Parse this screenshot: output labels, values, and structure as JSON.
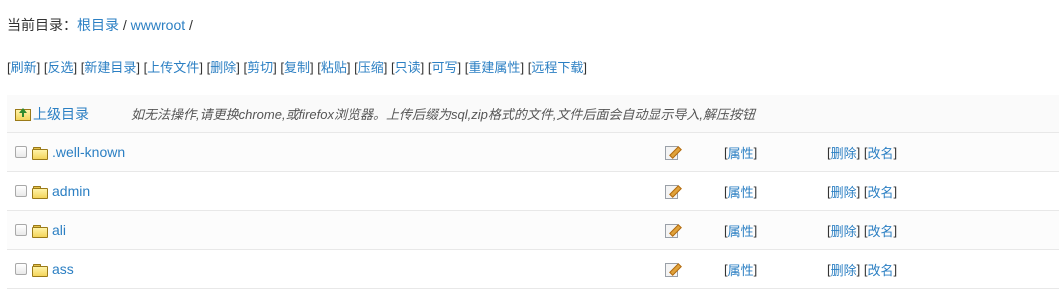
{
  "breadcrumb": {
    "prefix": "当前目录：",
    "root_label": "根目录",
    "sep1": " / ",
    "current": "wwwroot",
    "sep2": " /"
  },
  "toolbar": {
    "items": [
      "刷新",
      "反选",
      "新建目录",
      "上传文件",
      "删除",
      "剪切",
      "复制",
      "粘贴",
      "压缩",
      "只读",
      "可写",
      "重建属性",
      "远程下载"
    ]
  },
  "list": {
    "updir_label": "上级目录",
    "notice": "如无法操作,请更换chrome,或firefox浏览器。上传后缀为sql,zip格式的文件,文件后面会自动显示导入,解压按钮",
    "attr_label": "属性",
    "delete_label": "删除",
    "rename_label": "改名",
    "rows": [
      {
        "name": ".well-known"
      },
      {
        "name": "admin"
      },
      {
        "name": "ali"
      },
      {
        "name": "ass"
      }
    ]
  },
  "icons": {
    "folder": "folder-icon",
    "updir": "folder-up-icon",
    "edit": "edit-icon"
  }
}
